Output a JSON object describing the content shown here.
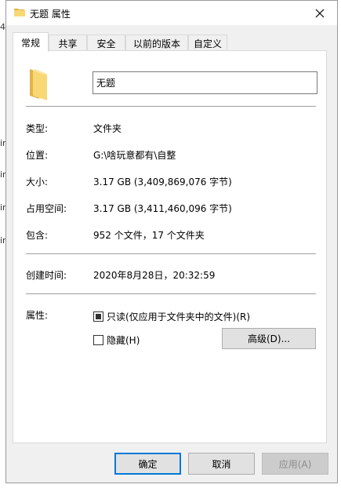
{
  "window": {
    "title": "无题 属性",
    "close_icon": "close-icon",
    "folder_icon": "folder-icon"
  },
  "background": {
    "fragments": [
      "4",
      "in",
      "in",
      "in",
      "in"
    ]
  },
  "tabs": [
    {
      "label": "常规",
      "active": true
    },
    {
      "label": "共享",
      "active": false
    },
    {
      "label": "安全",
      "active": false
    },
    {
      "label": "以前的版本",
      "active": false
    },
    {
      "label": "自定义",
      "active": false
    }
  ],
  "general": {
    "folder_name": "无题",
    "rows": [
      {
        "label": "类型:",
        "value": "文件夹"
      },
      {
        "label": "位置:",
        "value": "G:\\啥玩意都有\\自整"
      },
      {
        "label": "大小:",
        "value": "3.17 GB (3,409,869,076 字节)"
      },
      {
        "label": "占用空间:",
        "value": "3.17 GB (3,411,460,096 字节)"
      },
      {
        "label": "包含:",
        "value": "952 个文件，17 个文件夹"
      }
    ],
    "created_label": "创建时间:",
    "created_value": "2020年8月28日，20:32:59",
    "attributes_label": "属性:",
    "readonly_label": "只读(仅应用于文件夹中的文件)(R)",
    "readonly_state": "indeterminate",
    "hidden_label": "隐藏(H)",
    "hidden_state": "unchecked",
    "advanced_label": "高级(D)..."
  },
  "footer": {
    "ok_label": "确定",
    "cancel_label": "取消",
    "apply_label": "应用(A)"
  },
  "colors": {
    "folder": "#f8d775",
    "folder_dark": "#e0b44a",
    "primary_border": "#0078d7"
  }
}
